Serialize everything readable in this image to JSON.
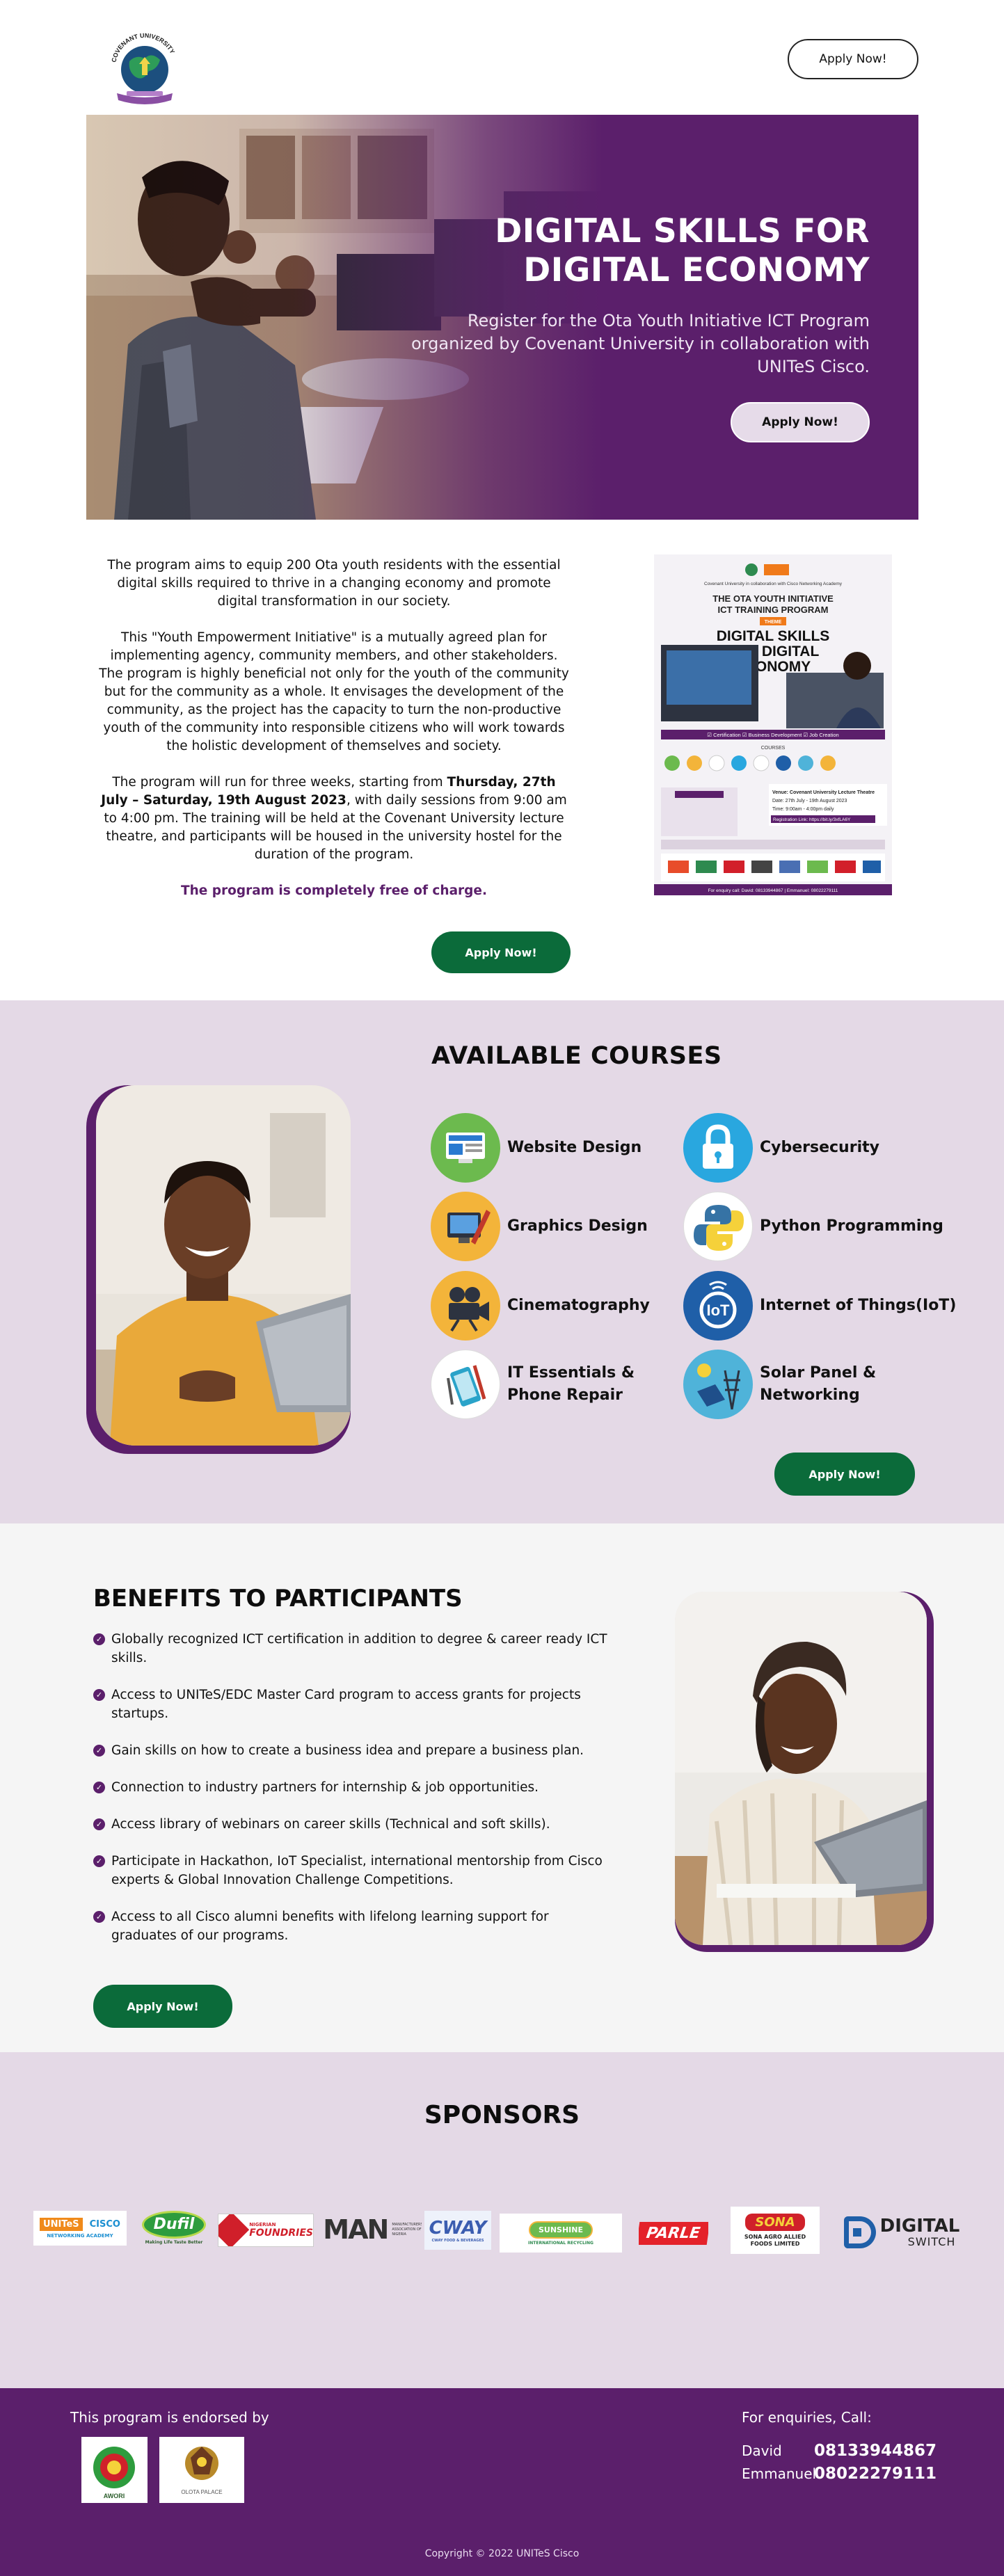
{
  "header": {
    "logo_text": "COVENANT UNIVERSITY",
    "apply_label": "Apply Now!"
  },
  "hero": {
    "title_line1": "DIGITAL SKILLS FOR",
    "title_line2": "DIGITAL ECONOMY",
    "subtitle": "Register for the Ota Youth Initiative ICT Program organized by Covenant University in collaboration with UNITeS Cisco.",
    "apply_label": "Apply Now!"
  },
  "about": {
    "p1": "The program aims to equip 200 Ota youth residents with the essential digital skills required to thrive in a changing economy and promote digital transformation in our society.",
    "p2": "This \"Youth Empowerment Initiative\" is a mutually agreed plan for implementing agency, community members, and other stakeholders. The program is highly beneficial not only for the youth of the community but for the community as a whole. It envisages the development of the community, as the project has the capacity to turn the non-productive youth of the community into responsible citizens who will work towards the holistic development of themselves and society.",
    "p3_prefix": "The program will run for three weeks, starting from ",
    "p3_dates": "Thursday, 27th July – Saturday, 19th August 2023",
    "p3_suffix": ", with daily sessions from 9:00 am to 4:00 pm. The training will be held at the Covenant University lecture theatre, and participants will be housed in the university hostel for the duration of the program.",
    "free": "The program is completely free of charge.",
    "apply_label": "Apply Now!"
  },
  "flyer": {
    "org": "Covenant University in collaboration with Cisco Networking Academy",
    "heading1": "THE OTA YOUTH INITIATIVE",
    "heading2": "ICT TRAINING PROGRAM",
    "theme": "THEME",
    "big1": "DIGITAL SKILLS",
    "big2": "FOR DIGITAL",
    "big3": "ECONOMY",
    "features": "☑ Certification  ☑ Business Development  ☑ Job Creation",
    "courses_label": "COURSES",
    "venue": "Venue: Covenant University Lecture Theatre",
    "date": "Date: 27th July - 19th August 2023",
    "time": "Time: 9:00am - 4:00pm daily",
    "reg": "Registration Link: https://bit.ly/3xfLA6Y",
    "enquiry": "For enquiry call: David: 08133944867 | Emmanuel: 08022279111"
  },
  "courses": {
    "title": "AVAILABLE COURSES",
    "items": [
      {
        "label": "Website  Design",
        "icon": "website-design-icon"
      },
      {
        "label": "Cybersecurity",
        "icon": "lock-icon"
      },
      {
        "label": "Graphics Design",
        "icon": "graphics-design-icon"
      },
      {
        "label": "Python Programming",
        "icon": "python-icon"
      },
      {
        "label": "Cinematography",
        "icon": "camera-icon"
      },
      {
        "label": "Internet of Things(IoT)",
        "icon": "iot-icon"
      },
      {
        "label": "IT Essentials &",
        "label2": "Phone Repair",
        "icon": "tools-icon"
      },
      {
        "label": "Solar Panel &",
        "label2": "Networking",
        "icon": "solar-panel-icon"
      }
    ],
    "apply_label": "Apply Now!"
  },
  "benefits": {
    "title": "BENEFITS TO PARTICIPANTS",
    "items": [
      "Globally recognized ICT certification in addition to degree & career ready ICT skills.",
      "Access to UNITeS/EDC Master Card program to access grants for projects startups.",
      "Gain skills on how to create a business idea and prepare a business plan.",
      "Connection to industry partners for internship & job opportunities.",
      "Access library of webinars on career skills (Technical and soft skills).",
      "Participate in Hackathon, IoT Specialist, international mentorship from Cisco experts & Global Innovation Challenge Competitions.",
      "Access to all Cisco alumni benefits with lifelong learning support for graduates of our programs."
    ],
    "apply_label": "Apply Now!"
  },
  "sponsors": {
    "title": "SPONSORS",
    "logos": [
      {
        "name": "UNITeS",
        "sub": "CISCO",
        "sub2": "NETWORKING ACADEMY"
      },
      {
        "name": "Dufil",
        "sub": "Making Life Taste Better"
      },
      {
        "name": "FOUNDRIES",
        "sub": "NIGERIAN"
      },
      {
        "name": "MAN",
        "sub": "MANUFACTURERS ASSOCIATION OF NIGERIA"
      },
      {
        "name": "CWAY",
        "sub": "CWAY FOOD & BEVERAGES"
      },
      {
        "name": "SUNSHINE",
        "sub": "INTERNATIONAL RECYCLING"
      },
      {
        "name": "PARLE"
      },
      {
        "name": "SONA",
        "sub": "SONA AGRO ALLIED FOODS LIMITED"
      },
      {
        "name": "DIGITAL",
        "sub": "SWITCH"
      }
    ]
  },
  "footer": {
    "endorsed_label": "This program is endorsed by",
    "endorsers": [
      {
        "name": "AWORI"
      },
      {
        "name": "OLOTA PALACE"
      }
    ],
    "enquiries_label": "For enquiries, Call:",
    "contacts": [
      {
        "name": "David",
        "phone": "08133944867"
      },
      {
        "name": "Emmanuel",
        "phone": "08022279111"
      }
    ],
    "copyright": "Copyright © 2022 UNITeS Cisco"
  },
  "colors": {
    "brand_purple": "#5b1f6b",
    "lavender": "#e4d9e6",
    "button_green": "#0b6b3a"
  }
}
